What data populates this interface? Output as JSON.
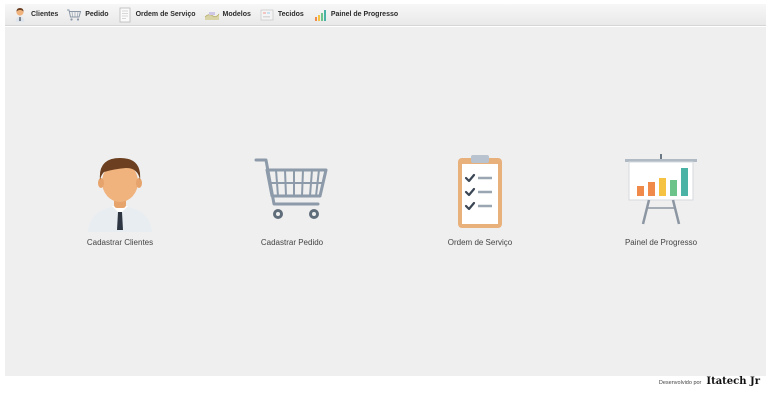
{
  "toolbar": {
    "items": [
      {
        "label": "Clientes",
        "icon": "person-icon"
      },
      {
        "label": "Pedido",
        "icon": "cart-icon"
      },
      {
        "label": "Ordem de Serviço",
        "icon": "document-icon"
      },
      {
        "label": "Modelos",
        "icon": "fabric-icon"
      },
      {
        "label": "Tecidos",
        "icon": "fabric-roll-icon"
      },
      {
        "label": "Painel de Progresso",
        "icon": "progress-chart-icon"
      }
    ]
  },
  "main": {
    "tiles": [
      {
        "label": "Cadastrar Clientes",
        "icon": "client-avatar-icon"
      },
      {
        "label": "Cadastrar Pedido",
        "icon": "shopping-cart-icon"
      },
      {
        "label": "Ordem de Serviço",
        "icon": "checklist-clipboard-icon"
      },
      {
        "label": "Painel de Progresso",
        "icon": "presentation-chart-icon"
      }
    ]
  },
  "footer": {
    "developed_by": "Desenvolvido por",
    "brand": "Itatech Jr"
  },
  "colors": {
    "background": "#efefef",
    "skin": "#f0b37e",
    "hair": "#6b3f1f",
    "clipboard": "#e8b07a",
    "chart_orange": "#f08a4b",
    "chart_yellow": "#f5c242",
    "chart_green": "#6cc48a",
    "chart_teal": "#4bb3a6"
  }
}
